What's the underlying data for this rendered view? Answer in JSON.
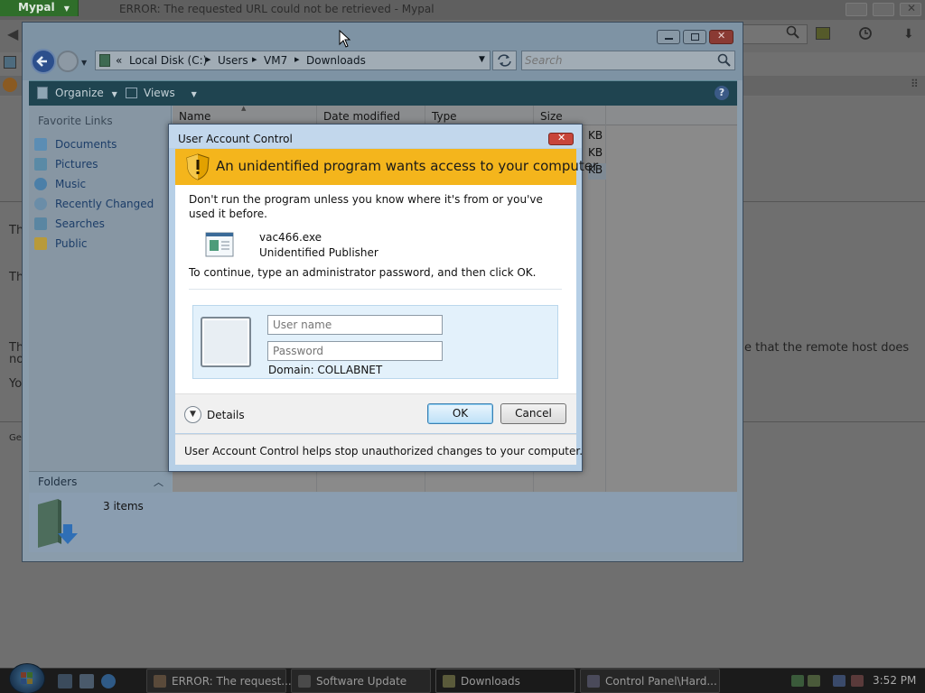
{
  "browser": {
    "app_badge": "Mypal",
    "title": "ERROR: The requested URL could not be retrieved - Mypal",
    "content": {
      "line_T1": "Th",
      "line_T2": "Th",
      "line_T3_left": "Th",
      "line_T3_left2": "no",
      "line_T3_right": "e that the remote host does",
      "line_Y": "Yo",
      "line_Ge": "Ge"
    }
  },
  "explorer": {
    "breadcrumb": {
      "overflow": "«",
      "items": [
        "Local Disk (C:)",
        "Users",
        "VM7",
        "Downloads"
      ]
    },
    "search_placeholder": "Search",
    "commands": {
      "organize": "Organize",
      "views": "Views",
      "help": "?"
    },
    "favorites_heading": "Favorite Links",
    "favorites": [
      {
        "label": "Documents",
        "icon": "documents-icon",
        "color": "#5b8db4"
      },
      {
        "label": "Pictures",
        "icon": "pictures-icon",
        "color": "#5a8aa6"
      },
      {
        "label": "Music",
        "icon": "music-icon",
        "color": "#4b7fa8"
      },
      {
        "label": "Recently Changed",
        "icon": "recent-icon",
        "color": "#6a8da8"
      },
      {
        "label": "Searches",
        "icon": "searches-icon",
        "color": "#5a86a2"
      },
      {
        "label": "Public",
        "icon": "public-icon",
        "color": "#b89a3a"
      }
    ],
    "columns": [
      "Name",
      "Date modified",
      "Type",
      "Size"
    ],
    "rows": [
      {
        "size": "KB"
      },
      {
        "size": "KB"
      },
      {
        "size": "KB"
      }
    ],
    "folders_label": "Folders",
    "details": "3 items"
  },
  "uac": {
    "title": "User Account Control",
    "banner": "An unidentified program wants access to your computer",
    "warning": "Don't run the program unless you know where it's from or you've used it before.",
    "program_name": "vac466.exe",
    "publisher": "Unidentified Publisher",
    "instruction": "To continue, type an administrator password, and then click OK.",
    "username_placeholder": "User name",
    "password_placeholder": "Password",
    "domain": "Domain: COLLABNET",
    "details_label": "Details",
    "ok_label": "OK",
    "cancel_label": "Cancel",
    "footnote": "User Account Control helps stop unauthorized changes to your computer.",
    "banner_color": "#f4b51c"
  },
  "taskbar": {
    "tasks": [
      {
        "label": "ERROR: The request...",
        "icon": "browser-icon"
      },
      {
        "label": "Software Update",
        "icon": "software-update-icon"
      },
      {
        "label": "Downloads",
        "icon": "folder-icon"
      },
      {
        "label": "Control Panel\\Hard...",
        "icon": "control-panel-icon"
      }
    ],
    "clock": "3:52 PM"
  }
}
